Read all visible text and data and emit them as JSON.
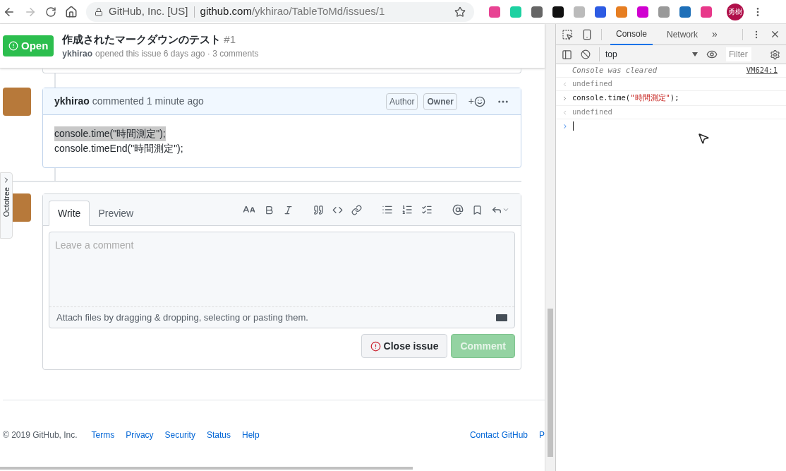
{
  "browser": {
    "security_label": "GitHub, Inc. [US]",
    "url_host": "github.com",
    "url_path": "/ykhirao/TableToMd/issues/1",
    "profile": "勇樹"
  },
  "issue": {
    "state": "Open",
    "title": "作成されたマークダウンのテスト",
    "number": "#1",
    "author": "ykhirao",
    "meta": "opened this issue 6 days ago · 3 comments"
  },
  "comment": {
    "author": "ykhirao",
    "meta": "commented 1 minute ago",
    "badges": [
      "Author",
      "Owner"
    ],
    "add_reaction": "+",
    "lines": [
      {
        "text": "console.time(\"時間測定\");",
        "selected": true
      },
      {
        "text": "console.timeEnd(\"時間測定\");",
        "selected": false
      }
    ]
  },
  "octotree": "Octotree",
  "editor": {
    "tabs": [
      {
        "label": "Write",
        "selected": true
      },
      {
        "label": "Preview",
        "selected": false
      }
    ],
    "placeholder": "Leave a comment",
    "attach_hint": "Attach files by dragging & dropping, selecting or pasting them.",
    "close_button": "Close issue",
    "comment_button": {
      "label": "Comment",
      "disabled": true
    }
  },
  "footer": {
    "copyright": "© 2019 GitHub, Inc.",
    "links": [
      "Terms",
      "Privacy",
      "Security",
      "Status",
      "Help"
    ],
    "right_links": [
      "Contact GitHub",
      "P"
    ]
  },
  "devtools": {
    "tabs": [
      {
        "label": "Console",
        "selected": true
      },
      {
        "label": "Network",
        "selected": false
      }
    ],
    "more": "»",
    "context": "top",
    "filter_placeholder": "Filter",
    "entries": [
      {
        "kind": "info",
        "text": "Console was cleared",
        "source": "VM624:1"
      },
      {
        "kind": "result",
        "text": "undefined"
      },
      {
        "kind": "input",
        "text": "console.time(",
        "string": "\"時間測定\"",
        "tail": ");"
      },
      {
        "kind": "result",
        "text": "undefined"
      },
      {
        "kind": "prompt"
      }
    ]
  }
}
